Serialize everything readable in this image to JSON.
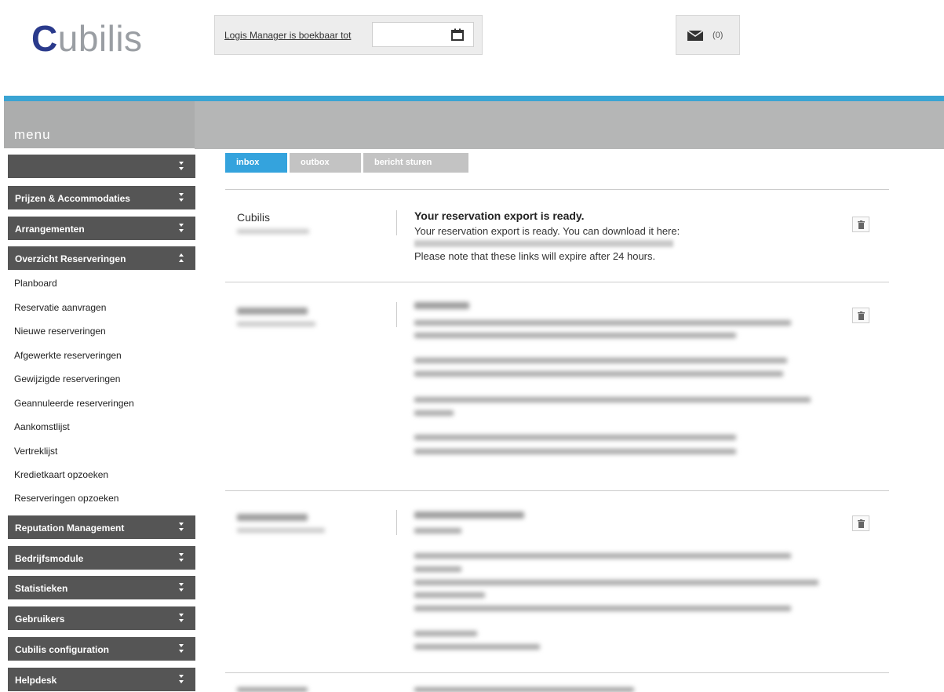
{
  "header": {
    "logo_first": "C",
    "logo_rest": "ubilis",
    "logis_link": "Logis Manager is boekbaar tot",
    "date_value": "",
    "mail_count": "(0)"
  },
  "sidebar": {
    "menu_label": "menu",
    "groups_top": [
      {
        "label": ""
      },
      {
        "label": "Prijzen & Accommodaties"
      },
      {
        "label": "Arrangementen"
      },
      {
        "label": "Overzicht Reserveringen"
      }
    ],
    "sub_items": [
      {
        "label": "Planboard"
      },
      {
        "label": "Reservatie aanvragen"
      },
      {
        "label": "Nieuwe reserveringen"
      },
      {
        "label": "Afgewerkte reserveringen"
      },
      {
        "label": "Gewijzigde reserveringen"
      },
      {
        "label": "Geannuleerde reserveringen"
      },
      {
        "label": "Aankomstlijst"
      },
      {
        "label": "Vertreklijst"
      },
      {
        "label": "Kredietkaart opzoeken"
      },
      {
        "label": "Reserveringen opzoeken"
      }
    ],
    "groups_bottom": [
      {
        "label": "Reputation Management"
      },
      {
        "label": "Bedrijfsmodule"
      },
      {
        "label": "Statistieken"
      },
      {
        "label": "Gebruikers"
      },
      {
        "label": "Cubilis configuration"
      },
      {
        "label": "Helpdesk"
      }
    ]
  },
  "tabs": [
    {
      "label": "inbox"
    },
    {
      "label": "outbox"
    },
    {
      "label": "bericht sturen"
    }
  ],
  "messages": [
    {
      "sender": "Cubilis",
      "subject": "Your reservation export is ready.",
      "line1": "Your reservation export is ready. You can download it here:",
      "line3": "Please note that these links will expire after 24 hours."
    }
  ],
  "colors": {
    "accent_blue": "#34a3dd",
    "header_line": "#3aa4d3",
    "menu_dark": "#555555"
  }
}
